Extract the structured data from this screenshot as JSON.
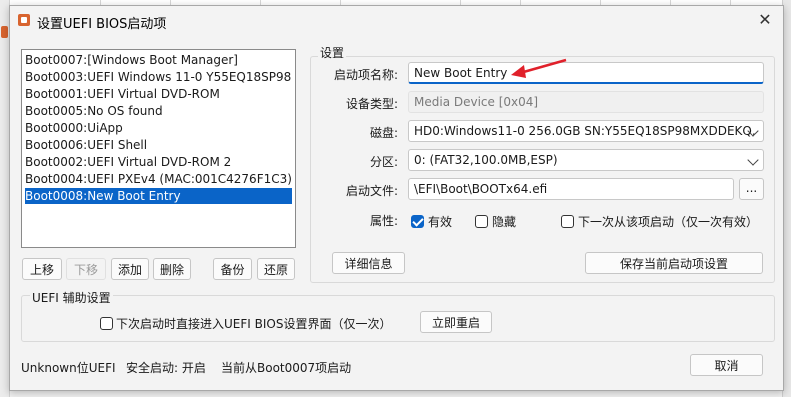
{
  "dialog": {
    "title": "设置UEFI BIOS启动项",
    "close_label": "✕"
  },
  "boot_entries": [
    {
      "label": "Boot0007:[Windows Boot Manager]",
      "selected": false
    },
    {
      "label": "Boot0003:UEFI Windows 11-0 Y55EQ18SP98M.",
      "selected": false
    },
    {
      "label": "Boot0001:UEFI Virtual DVD-ROM",
      "selected": false
    },
    {
      "label": "Boot0005:No OS found",
      "selected": false
    },
    {
      "label": "Boot0000:UiApp",
      "selected": false
    },
    {
      "label": "Boot0006:UEFI Shell",
      "selected": false
    },
    {
      "label": "Boot0002:UEFI Virtual DVD-ROM  2",
      "selected": false
    },
    {
      "label": "Boot0004:UEFI PXEv4 (MAC:001C4276F1C3)",
      "selected": false
    },
    {
      "label": "Boot0008:New Boot Entry",
      "selected": true
    }
  ],
  "list_buttons": {
    "move_up": "上移",
    "move_down": "下移",
    "add": "添加",
    "delete": "删除",
    "backup": "备份",
    "restore": "还原"
  },
  "settings": {
    "group_title": "设置",
    "name_label": "启动项名称:",
    "name_value": "New Boot Entry",
    "device_type_label": "设备类型:",
    "device_type_value": "Media Device [0x04]",
    "disk_label": "磁盘:",
    "disk_value": "HD0:Windows11-0 256.0GB SN:Y55EQ18SP98MXDDEKQ.",
    "partition_label": "分区:",
    "partition_value": "0: (FAT32,100.0MB,ESP)",
    "boot_file_label": "启动文件:",
    "boot_file_value": "\\EFI\\Boot\\BOOTx64.efi",
    "browse_label": "...",
    "attributes_label": "属性:",
    "attr_active_label": "有效",
    "attr_active_checked": true,
    "attr_hidden_label": "隐藏",
    "attr_hidden_checked": false,
    "attr_next_boot_label": "下一次从该项启动（仅一次有效）",
    "attr_next_boot_checked": false,
    "details_button": "详细信息",
    "save_button": "保存当前启动项设置"
  },
  "uefi_aux": {
    "group_title": "UEFI 辅助设置",
    "enter_bios_label": "下次启动时直接进入UEFI BIOS设置界面（仅一次）",
    "enter_bios_checked": false,
    "restart_button": "立即重启"
  },
  "status_bar": {
    "firmware": "Unknown位UEFI",
    "secure_boot": "安全启动: 开启",
    "current_boot": "当前从Boot0007项启动",
    "cancel_button": "取消"
  },
  "colors": {
    "accent": "#0a64c8",
    "annotation_arrow": "#e0202a"
  }
}
